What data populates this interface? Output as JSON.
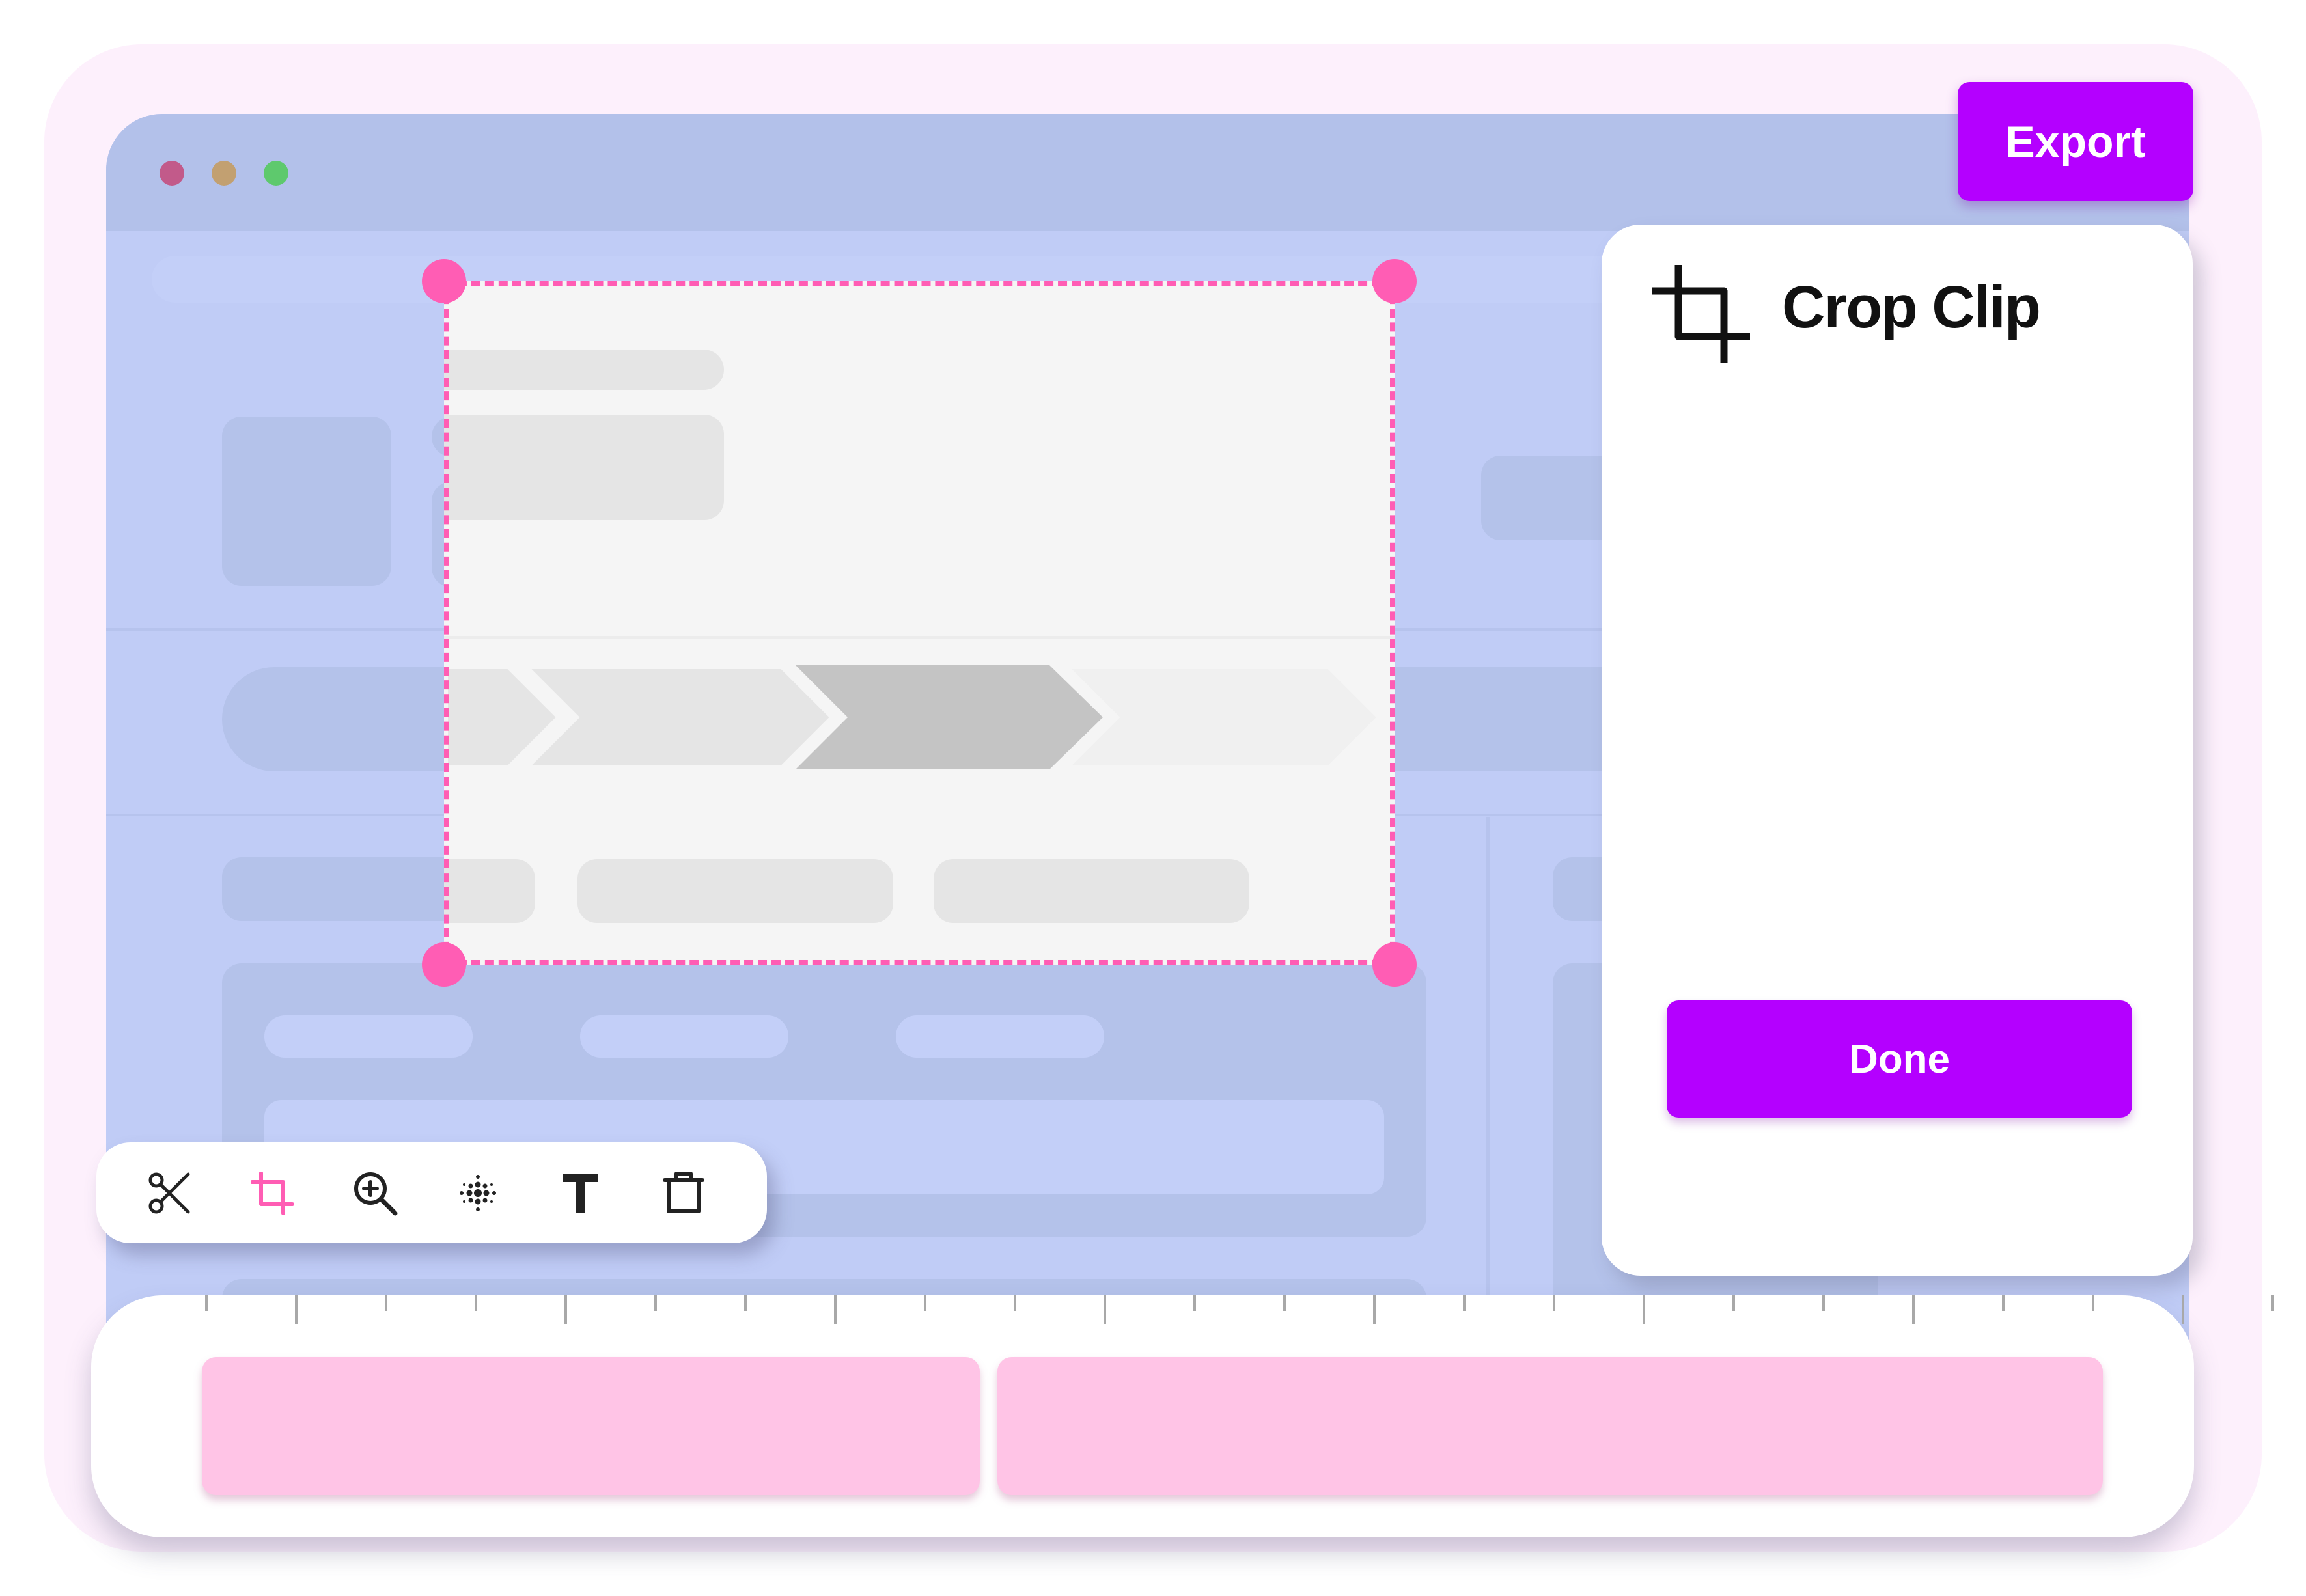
{
  "app": {
    "export_label": "Export"
  },
  "panel": {
    "icon": "crop-icon",
    "title": "Crop Clip",
    "done_label": "Done"
  },
  "toolbar": {
    "tools": [
      {
        "name": "scissors-icon",
        "active": false
      },
      {
        "name": "crop-icon",
        "active": true
      },
      {
        "name": "zoom-in-icon",
        "active": false
      },
      {
        "name": "blur-icon",
        "active": false
      },
      {
        "name": "text-icon",
        "active": false
      },
      {
        "name": "trash-icon",
        "active": false
      }
    ]
  },
  "timeline": {
    "clips": 2
  },
  "colors": {
    "accent": "#b400ff",
    "crop_border": "#ff5db4",
    "clip": "#ffc4e6",
    "window_bg": "#c0ccf6"
  }
}
